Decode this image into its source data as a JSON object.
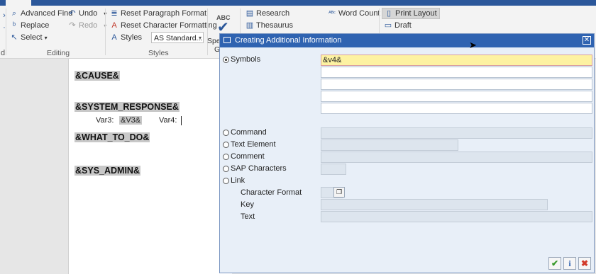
{
  "ribbon": {
    "editing": {
      "advanced_find": "Advanced Find",
      "replace": "Replace",
      "select": "Select",
      "undo": "Undo",
      "redo": "Redo",
      "group_label": "Editing"
    },
    "styles": {
      "reset_paragraph_format": "Reset Paragraph Format",
      "reset_character_formatting": "Reset Character Formatting",
      "styles_label": "Styles",
      "style_dropdown_value": "AS Standard...",
      "group_label": "Styles"
    },
    "proofing": {
      "abc": "ABC",
      "spelling_label": "Spelling &",
      "spelling_label2": "Gra"
    },
    "tools": {
      "research": "Research",
      "thesaurus": "Thesaurus",
      "word_count": "Word Count",
      "print_layout": "Print Layout",
      "draft": "Draft"
    },
    "left_cut": {
      "d": "d"
    }
  },
  "document": {
    "line1": "&CAUSE&",
    "line2": "&SYSTEM_RESPONSE&",
    "var3_label": "Var3:",
    "var3_value": "&V3&",
    "var4_label": "Var4:",
    "line3": "&WHAT_TO_DO&",
    "line4": "&SYS_ADMIN&"
  },
  "dialog": {
    "title": "Creating Additional Information",
    "options": {
      "symbols": "Symbols",
      "command": "Command",
      "text_element": "Text Element",
      "comment": "Comment",
      "sap_characters": "SAP Characters",
      "link": "Link"
    },
    "link_fields": {
      "character_format": "Character Format",
      "key": "Key",
      "text": "Text"
    },
    "symbols_value": "&v4&",
    "selected_option": "Symbols"
  },
  "colors": {
    "sap_title_bar": "#2f63b1",
    "sap_body": "#e8eff8",
    "active_field": "#fdf2a2",
    "word_accent": "#2b579a"
  }
}
